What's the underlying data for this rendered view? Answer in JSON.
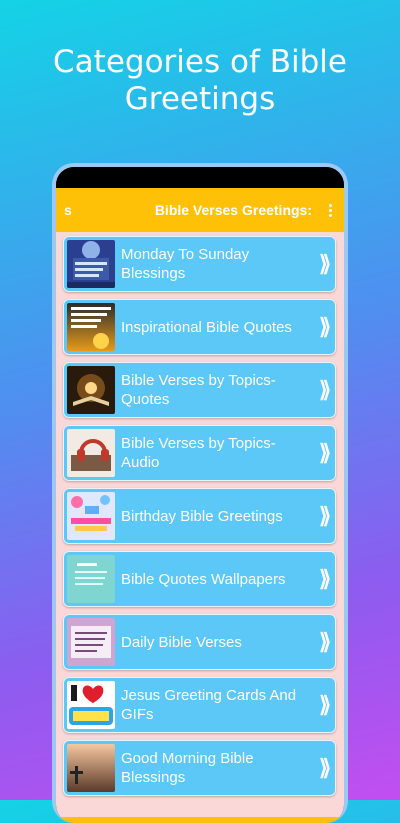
{
  "headline": "Categories of Bible\nGreetings",
  "appbar": {
    "left_fragment": "s",
    "title": "Bible Verses Greetings:"
  },
  "items": [
    {
      "label": "Monday To Sunday Blessings",
      "thumb": "sunday-blessing-thumbnail"
    },
    {
      "label": "Inspirational Bible Quotes",
      "thumb": "inspirational-quote-thumbnail"
    },
    {
      "label": "Bible Verses by Topics-Quotes",
      "thumb": "open-bible-thumbnail"
    },
    {
      "label": "Bible Verses by Topics-Audio",
      "thumb": "headphones-bible-thumbnail"
    },
    {
      "label": "Birthday Bible Greetings",
      "thumb": "birthday-card-thumbnail"
    },
    {
      "label": "Bible Quotes Wallpapers",
      "thumb": "wallpaper-thumbnail"
    },
    {
      "label": "Daily Bible Verses",
      "thumb": "daily-verse-thumbnail"
    },
    {
      "label": "Jesus Greeting Cards And GIFs",
      "thumb": "i-love-jesus-thumbnail"
    },
    {
      "label": "Good Morning Bible Blessings",
      "thumb": "good-morning-thumbnail"
    }
  ],
  "chevron": "⟫",
  "colors": {
    "accent": "#ffc107",
    "card": "#5cc8f8",
    "list_bg": "#fbd8d8"
  },
  "thumb_images": {
    "inspirational_text": "GIVE GOD YOUR PROBLEMS AND ALLOW HIM TO GIVE YOU SOLUTIONS.",
    "birthday_text": "Happy Birthday",
    "jesus_text": "Jesus!"
  }
}
